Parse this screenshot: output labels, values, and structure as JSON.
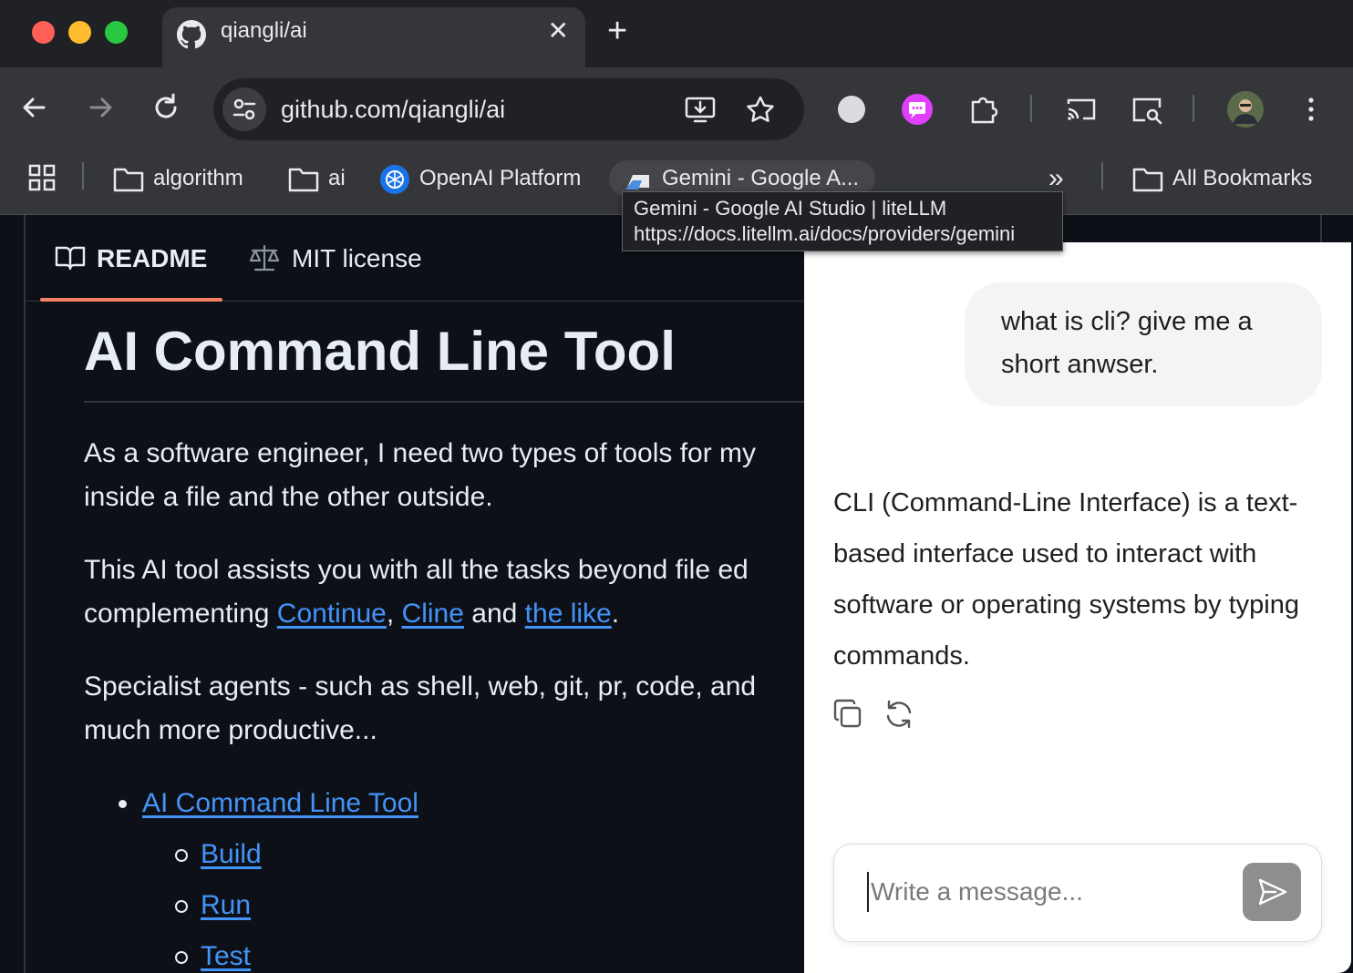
{
  "browser": {
    "tab": {
      "title": "qiangli/ai",
      "icon": "github-icon",
      "close_glyph": "✕"
    },
    "new_tab_glyph": "+",
    "url": "github.com/qiangli/ai",
    "bookmarks": [
      {
        "label": "algorithm",
        "icon": "folder-icon"
      },
      {
        "label": "ai",
        "icon": "folder-icon"
      },
      {
        "label": "OpenAI Platform",
        "icon": "openai-icon"
      },
      {
        "label": "Gemini - Google A...",
        "icon": "litellm-icon"
      }
    ],
    "overflow_glyph": "»",
    "all_bookmarks": "All Bookmarks",
    "tooltip": {
      "title": "Gemini - Google AI Studio | liteLLM",
      "url": "https://docs.litellm.ai/docs/providers/gemini"
    }
  },
  "readme": {
    "tabs": [
      {
        "label": "README",
        "icon": "book-icon",
        "active": true
      },
      {
        "label": "MIT license",
        "icon": "scale-icon",
        "active": false
      }
    ],
    "heading": "AI Command Line Tool",
    "para1_line1": "As a software engineer, I need two types of tools for my",
    "para1_line2": "inside a file and the other outside.",
    "para2_line1": "This AI tool assists you with all the tasks beyond file ed",
    "para2_prefix": "complementing ",
    "link_continue": "Continue",
    "comma": ",",
    "link_cline": "Cline",
    "and_text": " and ",
    "link_the_like": "the like",
    "period": ".",
    "para3_line1": "Specialist agents - such as shell, web, git, pr, code, and",
    "para3_line2": "much more productive...",
    "toc": {
      "top": "AI Command Line Tool",
      "children": [
        "Build",
        "Run",
        "Test"
      ]
    }
  },
  "chat": {
    "user_message": "what is cli? give me a short anwser.",
    "assistant_reply": "CLI (Command-Line Interface) is a text-based interface used to interact with software or operating systems by typing commands.",
    "composer_placeholder": "Write a message..."
  },
  "colors": {
    "page_bg": "#0d1117",
    "link": "#4493f8",
    "tab_underline": "#f78166",
    "chrome_bg": "#35363a"
  }
}
